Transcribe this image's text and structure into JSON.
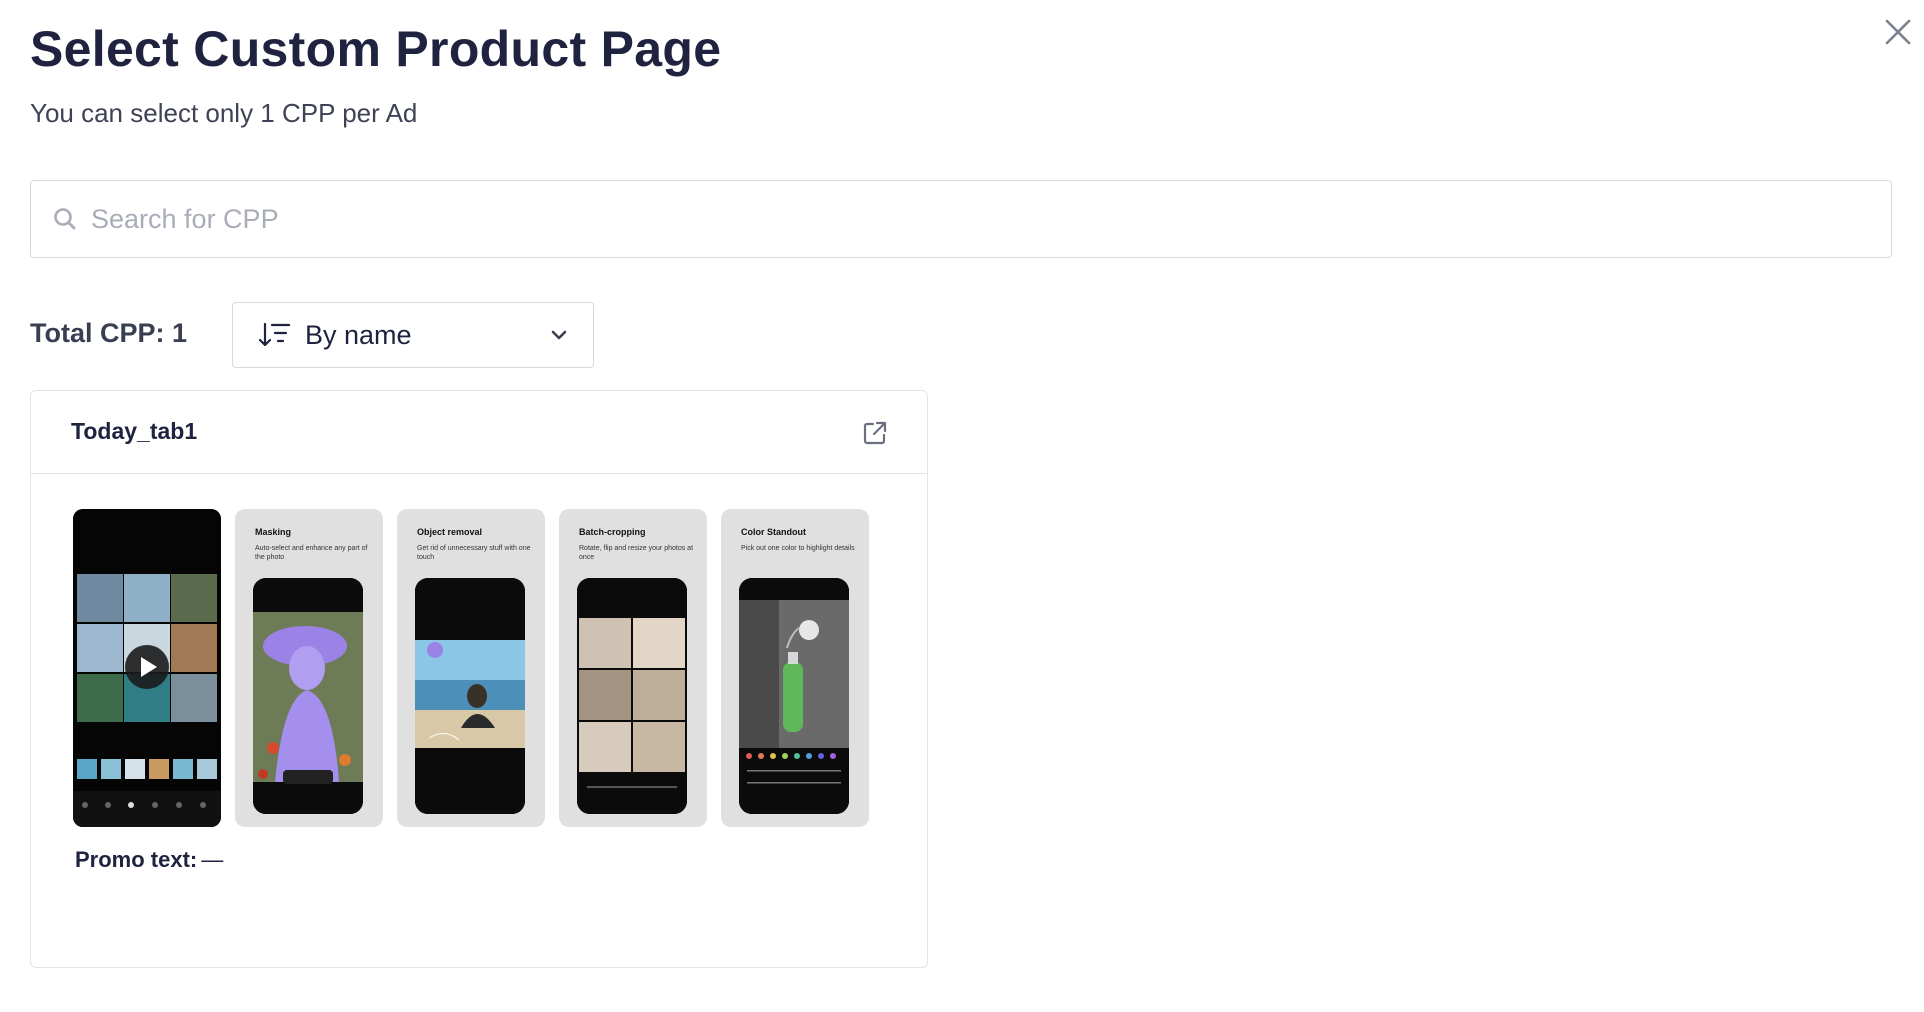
{
  "dialog": {
    "title": "Select Custom Product Page",
    "subtitle": "You can select only 1 CPP per Ad",
    "close_icon": "close-icon"
  },
  "search": {
    "placeholder": "Search for CPP",
    "value": "",
    "icon": "search-icon"
  },
  "summary": {
    "total_label": "Total CPP: 1"
  },
  "sort": {
    "selected": "By name",
    "icon": "sort-descending-icon",
    "chevron": "chevron-down-icon"
  },
  "cpp_list": [
    {
      "name": "Today_tab1",
      "link_icon": "external-link-icon",
      "screenshots": [
        {
          "title": "",
          "subtitle": ""
        },
        {
          "title": "Masking",
          "subtitle": "Auto-select and enhance any part of the photo"
        },
        {
          "title": "Object removal",
          "subtitle": "Get rid of unnecessary stuff with one touch"
        },
        {
          "title": "Batch-cropping",
          "subtitle": "Rotate, flip and resize your photos at once"
        },
        {
          "title": "Color Standout",
          "subtitle": "Pick out one color to highlight details"
        }
      ],
      "promo_label": "Promo text:",
      "promo_value": "—"
    }
  ],
  "colors": {
    "title": "#1f2340",
    "border": "#d5d8e0",
    "masking_accent": "#9b82e6",
    "standout_green": "#5fb85a"
  }
}
